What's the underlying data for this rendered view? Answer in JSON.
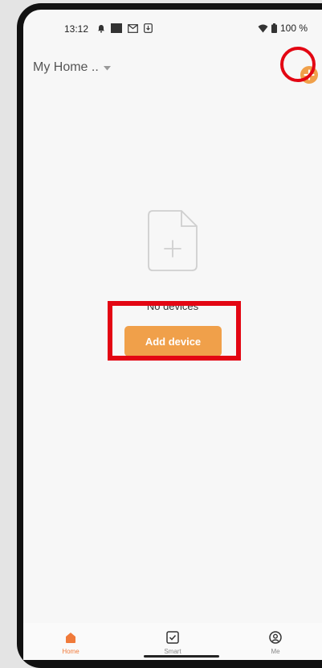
{
  "status_bar": {
    "time": "13:12",
    "battery": "100 %"
  },
  "header": {
    "home_name": "My Home .."
  },
  "empty_state": {
    "message": "No devices",
    "add_device_label": "Add device"
  },
  "tabbar": {
    "items": [
      {
        "label": "Home"
      },
      {
        "label": "Smart"
      },
      {
        "label": "Me"
      }
    ]
  },
  "colors": {
    "accent": "#f0a04a",
    "active_tab": "#f07a3a",
    "highlight": "#e30613"
  }
}
